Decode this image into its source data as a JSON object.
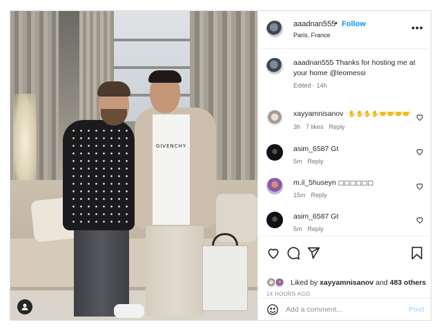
{
  "post": {
    "author": "aaadnan555",
    "separator": "•",
    "follow_label": "Follow",
    "location": "Paris, France",
    "more_label": "•••",
    "photo_logo_text": "GIVENCHY",
    "caption": {
      "username": "aaadnan555",
      "text": " Thanks for hosting me at your home @leomessi",
      "edited": "Edited · 14h"
    }
  },
  "comments": [
    {
      "username": "xayyamnisanov",
      "text": "✋✋✋✋🤝🤝🤝🤝",
      "time": "3h",
      "likes": "7 likes",
      "reply": "Reply"
    },
    {
      "username": "asim_6587",
      "text": " Gt",
      "time": "5m",
      "reply": "Reply"
    },
    {
      "username": "m.il_5huseyn",
      "text": " □□□□□□",
      "time": "15m",
      "reply": "Reply"
    },
    {
      "username": "asim_6587",
      "text": " Gt",
      "time": "5m",
      "reply": "Reply"
    }
  ],
  "likes": {
    "prefix": "Liked by ",
    "user": "xayyamnisanov",
    "middle": " and ",
    "others": "483 others"
  },
  "timestamp": "14 HOURS AGO",
  "add_comment": {
    "placeholder": "Add a comment...",
    "post_label": "Post"
  },
  "colors": {
    "accent": "#0095f6",
    "post_disabled": "#b3dbff",
    "muted": "#737373"
  },
  "icons": [
    "user-tag-icon",
    "more-icon",
    "heart-icon",
    "comment-icon",
    "share-icon",
    "bookmark-icon",
    "emoji-icon"
  ]
}
